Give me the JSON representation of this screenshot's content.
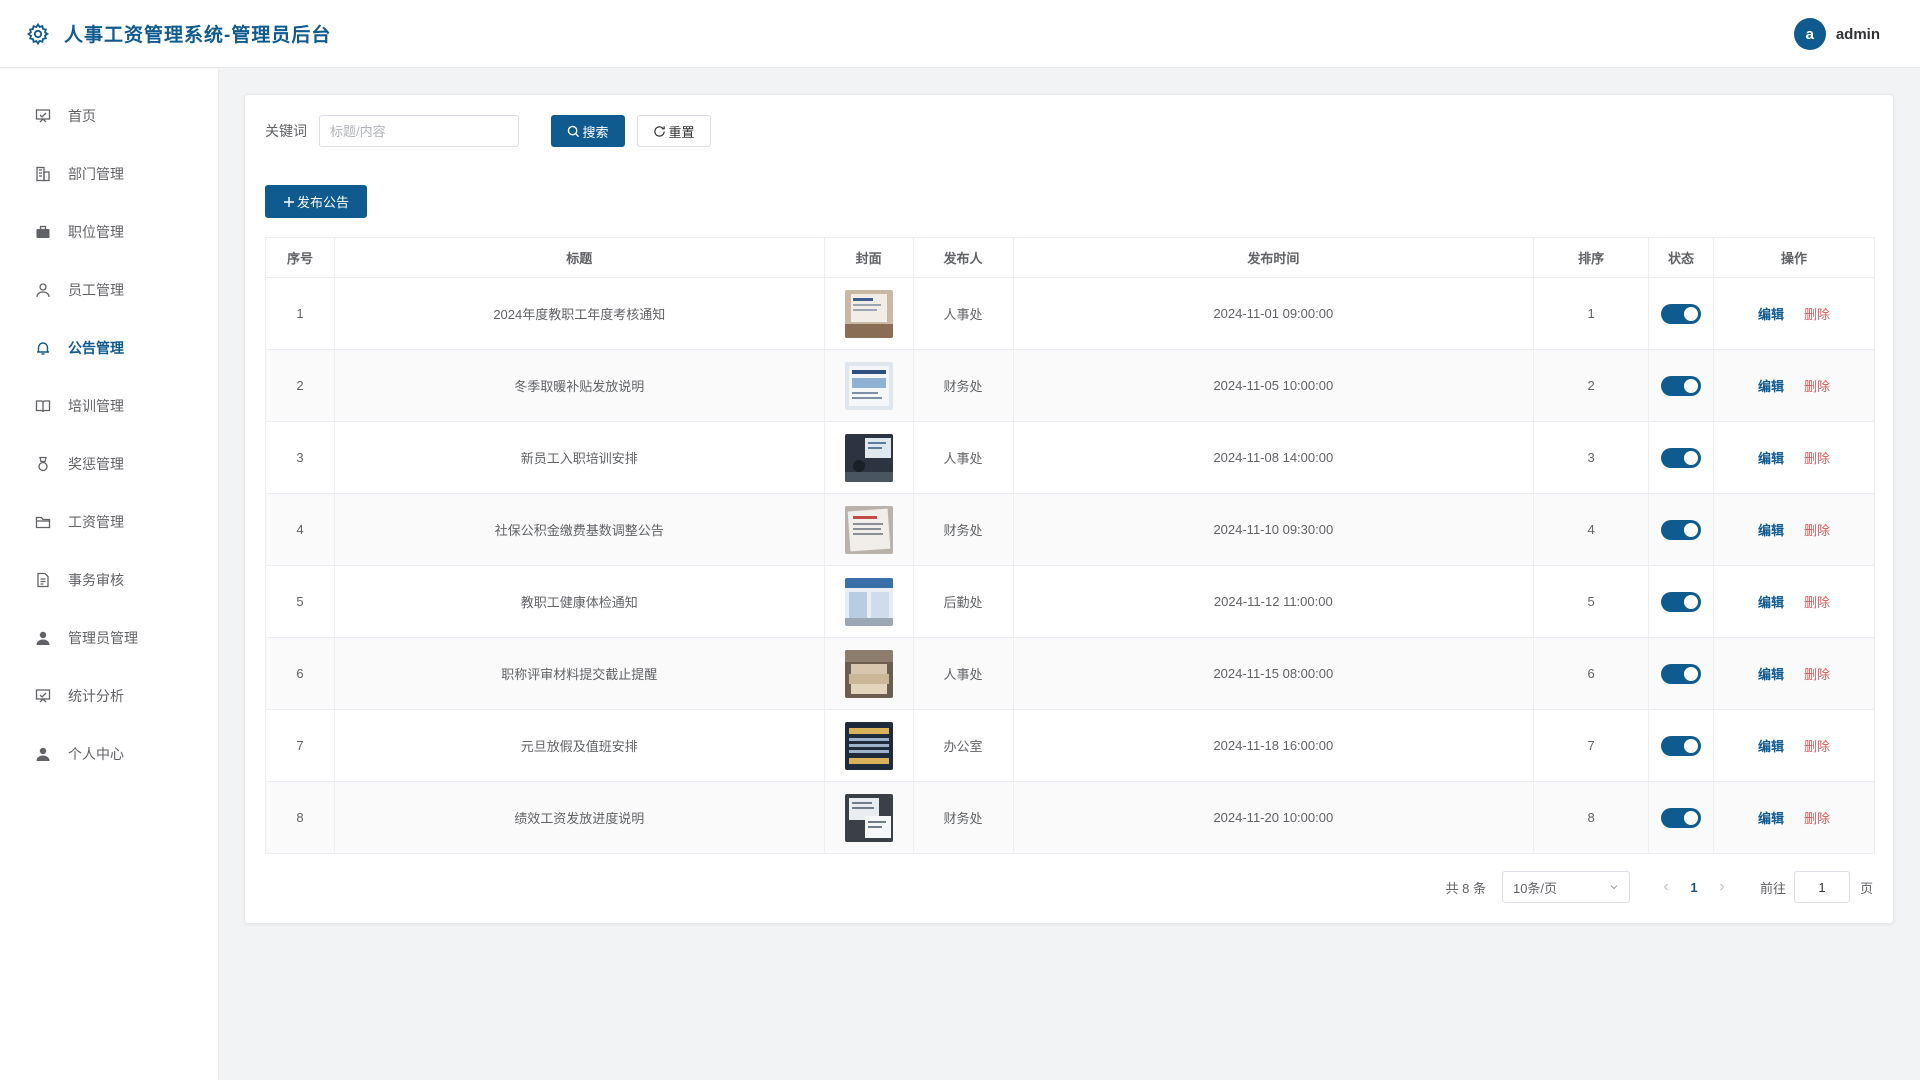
{
  "header": {
    "title": "人事工资管理系统-管理员后台",
    "avatar_letter": "a",
    "username": "admin"
  },
  "sidebar": {
    "items": [
      {
        "label": "首页",
        "icon": "presentation-icon"
      },
      {
        "label": "部门管理",
        "icon": "building-icon"
      },
      {
        "label": "职位管理",
        "icon": "briefcase-icon"
      },
      {
        "label": "员工管理",
        "icon": "user-icon"
      },
      {
        "label": "公告管理",
        "icon": "bell-icon",
        "active": true
      },
      {
        "label": "培训管理",
        "icon": "book-icon"
      },
      {
        "label": "奖惩管理",
        "icon": "medal-icon"
      },
      {
        "label": "工资管理",
        "icon": "folder-icon"
      },
      {
        "label": "事务审核",
        "icon": "document-icon"
      },
      {
        "label": "管理员管理",
        "icon": "user-filled-icon"
      },
      {
        "label": "统计分析",
        "icon": "presentation-icon"
      },
      {
        "label": "个人中心",
        "icon": "user-filled-icon"
      }
    ]
  },
  "search": {
    "label": "关键词",
    "placeholder": "标题/内容",
    "value": "",
    "search_button": "搜索",
    "reset_button": "重置"
  },
  "add_button": "发布公告",
  "table": {
    "headers": [
      "序号",
      "标题",
      "封面",
      "发布人",
      "发布时间",
      "排序",
      "状态",
      "操作"
    ],
    "edit_label": "编辑",
    "delete_label": "删除",
    "rows": [
      {
        "index": "1",
        "title": "2024年度教职工年度考核通知",
        "publisher": "人事处",
        "time": "2024-11-01 09:00:00",
        "order": "1",
        "enabled": true
      },
      {
        "index": "2",
        "title": "冬季取暖补贴发放说明",
        "publisher": "财务处",
        "time": "2024-11-05 10:00:00",
        "order": "2",
        "enabled": true
      },
      {
        "index": "3",
        "title": "新员工入职培训安排",
        "publisher": "人事处",
        "time": "2024-11-08 14:00:00",
        "order": "3",
        "enabled": true
      },
      {
        "index": "4",
        "title": "社保公积金缴费基数调整公告",
        "publisher": "财务处",
        "time": "2024-11-10 09:30:00",
        "order": "4",
        "enabled": true
      },
      {
        "index": "5",
        "title": "教职工健康体检通知",
        "publisher": "后勤处",
        "time": "2024-11-12 11:00:00",
        "order": "5",
        "enabled": true
      },
      {
        "index": "6",
        "title": "职称评审材料提交截止提醒",
        "publisher": "人事处",
        "time": "2024-11-15 08:00:00",
        "order": "6",
        "enabled": true
      },
      {
        "index": "7",
        "title": "元旦放假及值班安排",
        "publisher": "办公室",
        "time": "2024-11-18 16:00:00",
        "order": "7",
        "enabled": true
      },
      {
        "index": "8",
        "title": "绩效工资发放进度说明",
        "publisher": "财务处",
        "time": "2024-11-20 10:00:00",
        "order": "8",
        "enabled": true
      }
    ]
  },
  "pagination": {
    "total": "共 8 条",
    "page_size": "10条/页",
    "current_page": "1",
    "goto_label": "前往",
    "goto_value": "1",
    "page_unit": "页"
  },
  "colors": {
    "primary": "#0f5a8e",
    "danger": "#e05a5a"
  }
}
